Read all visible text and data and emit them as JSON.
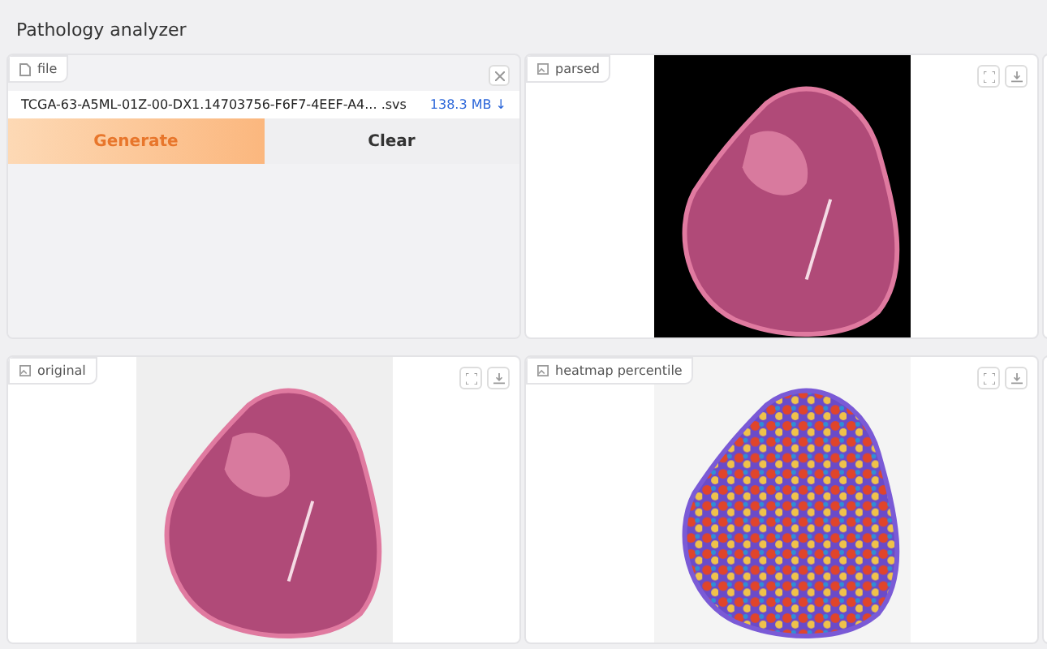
{
  "app": {
    "title": "Pathology analyzer"
  },
  "file_panel": {
    "label": "file",
    "file_name": "TCGA-63-A5ML-01Z-00-DX1.14703756-F6F7-4EEF-A4... .svs",
    "file_size": "138.3 MB ↓"
  },
  "buttons": [
    {
      "label": "Generate",
      "kind": "primary"
    },
    {
      "label": "Clear",
      "kind": "secondary"
    }
  ],
  "image_panels": [
    {
      "label": "parsed",
      "kind": "mask"
    },
    {
      "label": "original",
      "kind": "slide"
    },
    {
      "label": "heatmap percentile",
      "kind": "heatmap"
    }
  ]
}
